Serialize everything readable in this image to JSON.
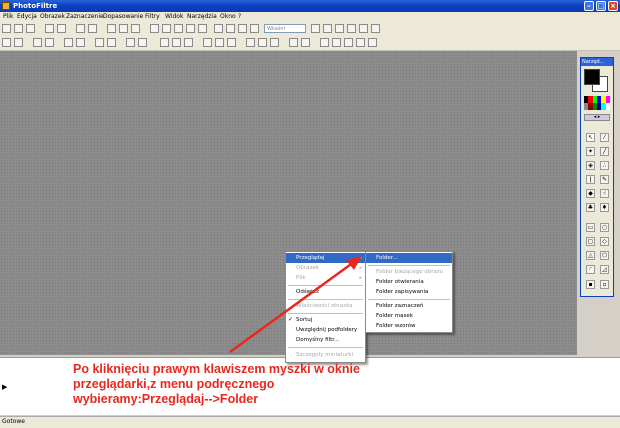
{
  "window": {
    "title": "PhotoFiltre"
  },
  "menubar": [
    "Plik",
    "Edycja",
    "Obrazek",
    "Zaznaczenie",
    "Dopasowanie",
    "Filtry",
    "Widok",
    "Narzędzia",
    "Okno",
    "?"
  ],
  "toolbar": {
    "zoom_placeholder": "Wkaśnr"
  },
  "palette": {
    "title": "Narzęd..."
  },
  "context_menu": {
    "items": [
      {
        "label": "Przeglądaj",
        "state": "highlighted",
        "submenu": true
      },
      {
        "label": "Obrazek",
        "state": "disabled",
        "submenu": true
      },
      {
        "label": "Plik",
        "state": "disabled",
        "submenu": true
      },
      {
        "label": "Odśwież",
        "state": "normal"
      },
      {
        "label": "Właściwości obrazka",
        "state": "disabled"
      },
      {
        "label": "Sortuj",
        "state": "checked"
      },
      {
        "label": "Uwzględnij podfoldery",
        "state": "normal"
      },
      {
        "label": "Domyślny filtr...",
        "state": "normal"
      },
      {
        "label": "Szczegóły miniaturki",
        "state": "disabled"
      }
    ]
  },
  "submenu": {
    "items": [
      {
        "label": "Folder...",
        "state": "highlighted"
      },
      {
        "label": "Folder bieżącego obrazu",
        "state": "disabled"
      },
      {
        "label": "Folder otwierania",
        "state": "normal"
      },
      {
        "label": "Folder zapisywania",
        "state": "normal"
      },
      {
        "label": "Folder zaznaczeń",
        "state": "normal"
      },
      {
        "label": "Folder masek",
        "state": "normal"
      },
      {
        "label": "Folder wzorów",
        "state": "normal"
      }
    ]
  },
  "annotation": {
    "line1": "Po kliknięciu prawym klawiszem myszki w oknie",
    "line2": "przeglądarki,z menu podręcznego",
    "line3": "wybieramy:Przeglądaj-->Folder",
    "color": "#e8281e"
  },
  "statusbar": {
    "text": "Gotowe"
  }
}
